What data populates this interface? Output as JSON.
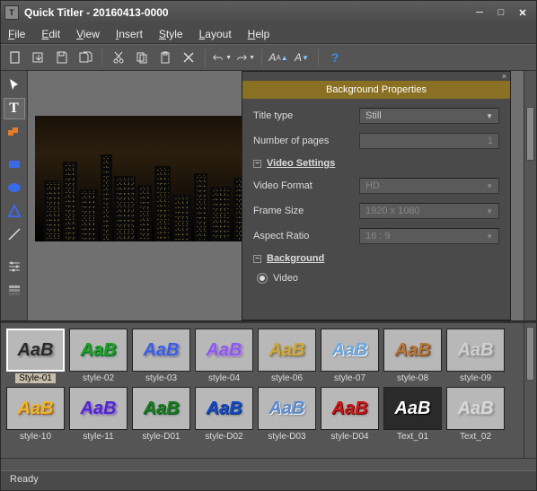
{
  "window": {
    "title": "Quick Titler - 20160413-0000"
  },
  "menu": {
    "file": "File",
    "edit": "Edit",
    "view": "View",
    "insert": "Insert",
    "style": "Style",
    "layout": "Layout",
    "help": "Help"
  },
  "props": {
    "title": "Background Properties",
    "title_type_label": "Title type",
    "title_type_value": "Still",
    "num_pages_label": "Number of pages",
    "num_pages_value": "1",
    "video_settings": "Video Settings",
    "video_format_label": "Video Format",
    "video_format_value": "HD",
    "frame_size_label": "Frame Size",
    "frame_size_value": "1920 x 1080",
    "aspect_label": "Aspect Ratio",
    "aspect_value": "16 : 9",
    "background": "Background",
    "bg_video": "Video"
  },
  "styles": {
    "r1": [
      {
        "label": "Style-01",
        "color": "#2a2a2a",
        "shadow": "#888"
      },
      {
        "label": "style-02",
        "color": "#1fa01f",
        "shadow": "#063"
      },
      {
        "label": "style-03",
        "color": "#3a5de8",
        "shadow": "#88a"
      },
      {
        "label": "style-04",
        "color": "#8a5be8",
        "shadow": "#b8e"
      },
      {
        "label": "style-06",
        "color": "#cfa83a",
        "shadow": "#875"
      },
      {
        "label": "style-07",
        "color": "#6aa8e0",
        "shadow": "#fff"
      },
      {
        "label": "style-08",
        "color": "#b8783a",
        "shadow": "#643"
      },
      {
        "label": "style-09",
        "color": "#d0d0d0",
        "shadow": "#999"
      }
    ],
    "r2": [
      {
        "label": "style-10",
        "color": "#e8b828",
        "shadow": "#a52"
      },
      {
        "label": "style-11",
        "color": "#5128c8",
        "shadow": "#96e"
      },
      {
        "label": "style-D01",
        "color": "#1f7a1f",
        "shadow": "#052"
      },
      {
        "label": "style-D02",
        "color": "#1848c8",
        "shadow": "#036"
      },
      {
        "label": "style-D03",
        "color": "#5a8ad0",
        "shadow": "#fff"
      },
      {
        "label": "style-D04",
        "color": "#c81818",
        "shadow": "#600"
      },
      {
        "label": "Text_01",
        "color": "#ffffff",
        "shadow": "#000",
        "bg": "#2a2a2a"
      },
      {
        "label": "Text_02",
        "color": "#d8d8d8",
        "shadow": "#aaa"
      }
    ]
  },
  "status": "Ready"
}
